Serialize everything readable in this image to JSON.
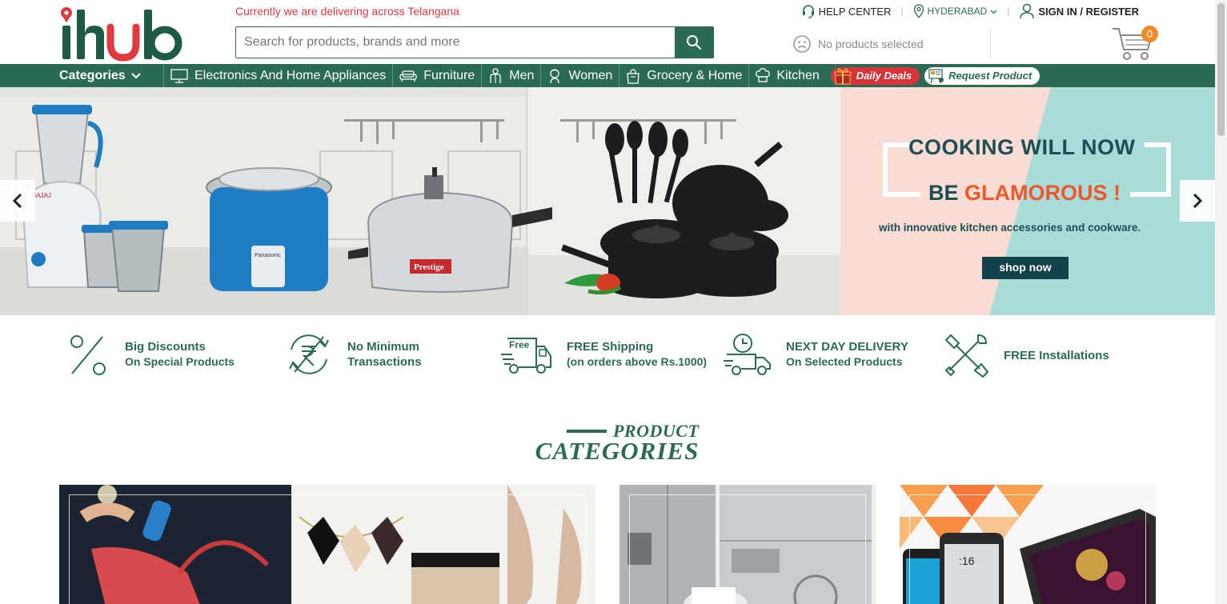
{
  "header": {
    "logo_text": "ihub",
    "delivery_note": "Currently we are delivering across Telangana",
    "search_placeholder": "Search for products, brands and more",
    "help_center": "HELP CENTER",
    "location": "HYDERABAD",
    "sign_in": "SIGN IN / REGISTER",
    "no_products": "No products selected",
    "cart_count": "0"
  },
  "nav": {
    "categories": "Categories",
    "items": [
      {
        "label": "Electronics And Home Appliances",
        "icon": "monitor-icon"
      },
      {
        "label": "Furniture",
        "icon": "sofa-icon"
      },
      {
        "label": "Men",
        "icon": "man-icon"
      },
      {
        "label": "Women",
        "icon": "woman-icon"
      },
      {
        "label": "Grocery & Home",
        "icon": "grocery-bag-icon"
      },
      {
        "label": "Kitchen",
        "icon": "chef-hat-icon"
      }
    ],
    "daily_deals": "Daily Deals",
    "request_product": "Request Product"
  },
  "banner": {
    "line1": "COOKING WILL NOW",
    "line2_prefix": "BE ",
    "line2_highlight": "GLAMOROUS !",
    "subtitle": "with innovative kitchen accessories and cookware.",
    "button": "shop now",
    "brand_cooker": "Prestige"
  },
  "features": [
    {
      "title": "Big Discounts",
      "sub": "On Special Products",
      "icon": "percent-icon"
    },
    {
      "title": "No Minimum",
      "sub": "Transactions",
      "icon": "rupee-cycle-icon"
    },
    {
      "title": "FREE Shipping",
      "sub": "(on orders above Rs.1000)",
      "icon": "free-truck-icon",
      "badge": "Free"
    },
    {
      "title": "NEXT DAY DELIVERY",
      "sub": "On Selected Products",
      "icon": "clock-truck-icon"
    },
    {
      "title": "FREE Installations",
      "sub": "",
      "icon": "tools-icon"
    }
  ],
  "section": {
    "title_line1": "PRODUCT",
    "title_line2": "CATEGORIES"
  },
  "colors": {
    "brand_green": "#2b6b55",
    "alert_red": "#e0393e",
    "accent_orange": "#f18a2c",
    "promo_teal": "#1e4d54",
    "promo_orange": "#f2572c"
  }
}
